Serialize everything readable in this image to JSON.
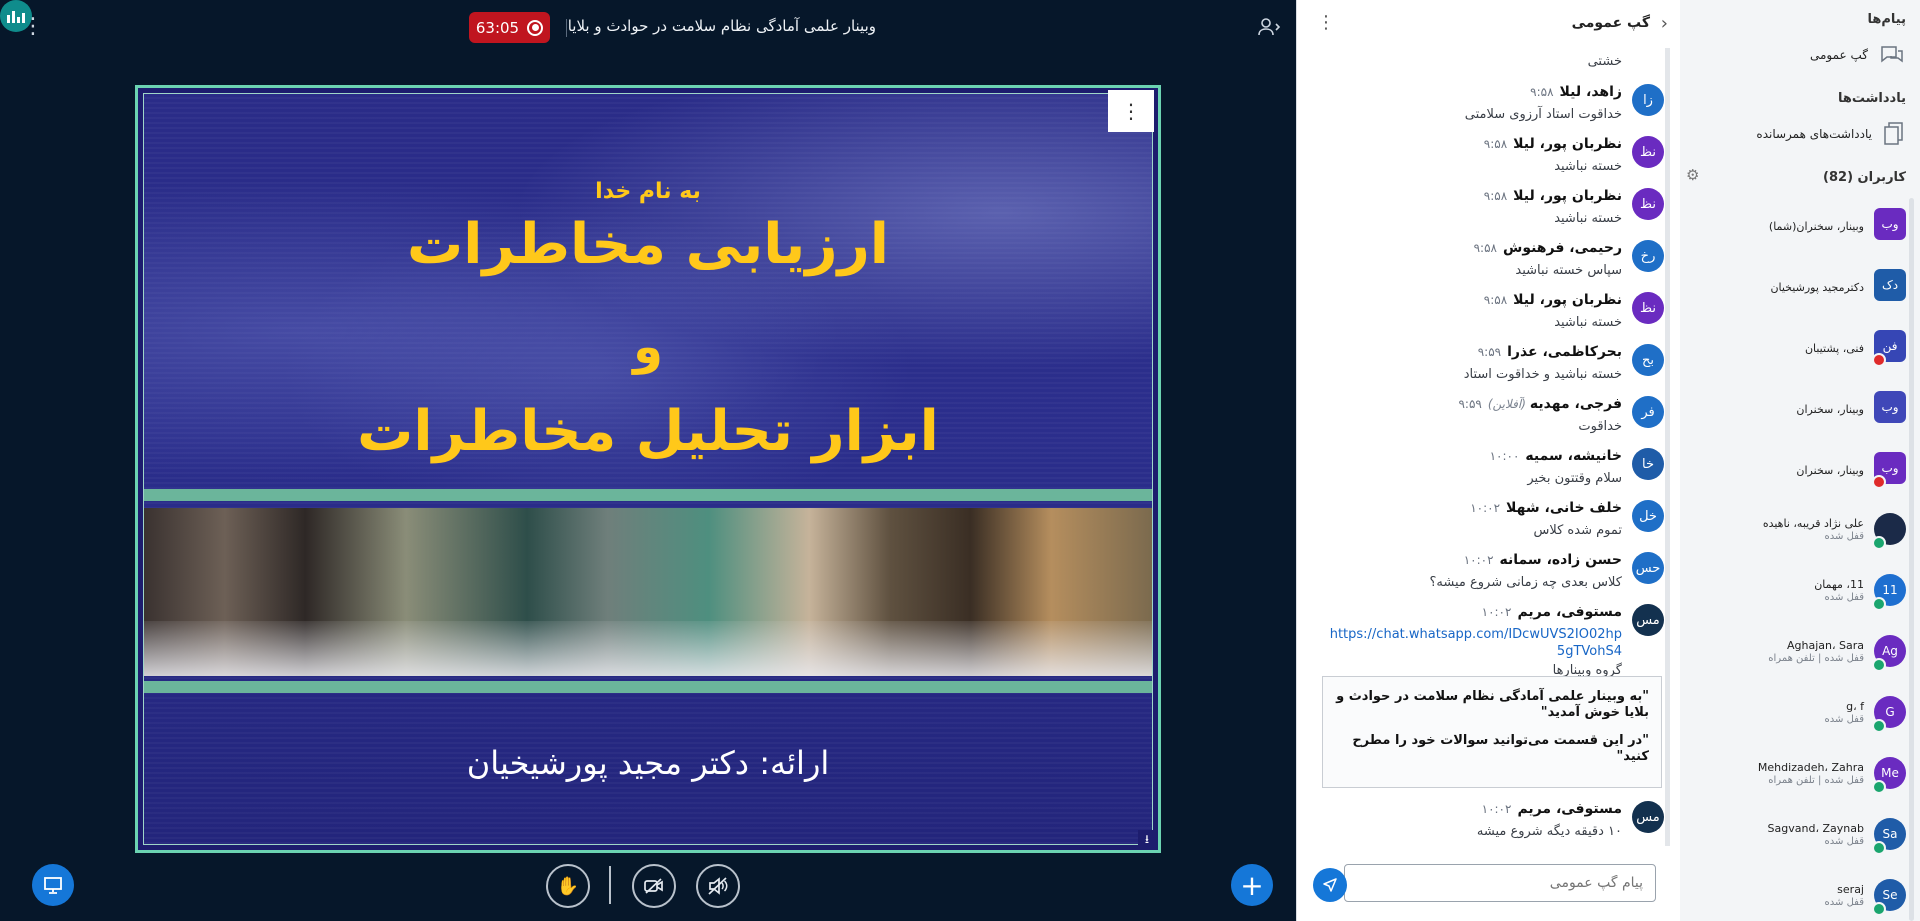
{
  "header": {
    "timer": "63:05",
    "meeting_title": "وبینار علمی آمادگی نظام سلامت در حوادث و بلایا"
  },
  "slide": {
    "line1": "به نام خدا",
    "title1": "ارزیابی مخاطرات",
    "and": "و",
    "title2": "ابزار تحلیل مخاطرات",
    "presenter": "ارائه: دکتر مجید پورشیخیان"
  },
  "chat": {
    "title": "گپ عمومی",
    "partial_text": "خشتی",
    "messages": [
      {
        "initials": "زا",
        "color": "#1f6fc7",
        "name": "زاهد، لیلا",
        "time": "۹:۵۸",
        "text": "خداقوت استاد آرزوی سلامتی"
      },
      {
        "initials": "نظ",
        "color": "#6a2bc0",
        "name": "نظربان پور، لیلا",
        "time": "۹:۵۸",
        "text": "خسته نباشید"
      },
      {
        "initials": "نظ",
        "color": "#6a2bc0",
        "name": "نظربان پور، لیلا",
        "time": "۹:۵۸",
        "text": "خسته نباشید"
      },
      {
        "initials": "رخ",
        "color": "#1f6fc7",
        "name": "رحیمی، فرهنوش",
        "time": "۹:۵۸",
        "text": "سپاس خسته نباشید"
      },
      {
        "initials": "نظ",
        "color": "#6a2bc0",
        "name": "نظربان پور، لیلا",
        "time": "۹:۵۸",
        "text": "خسته نباشید"
      },
      {
        "initials": "بح",
        "color": "#1f6fc7",
        "name": "بحرکاظمی، عذرا",
        "time": "۹:۵۹",
        "text": "خسته نباشید و خداقوت استاد"
      },
      {
        "initials": "فر",
        "color": "#1f6fc7",
        "name": "فرجی، مهدیه",
        "offline": "(آفلاین)",
        "time": "۹:۵۹",
        "text": "خداقوت"
      },
      {
        "initials": "خا",
        "color": "#1f5ca8",
        "name": "خانیشه، سمیه",
        "time": "۱۰:۰۰",
        "text": "سلام وقتتون بخیر"
      },
      {
        "initials": "خل",
        "color": "#1f6fc7",
        "name": "خلف خانی، شهلا",
        "time": "۱۰:۰۲",
        "text": "تموم شده کلاس"
      },
      {
        "initials": "حس",
        "color": "#1f6fc7",
        "name": "حسن زاده، سمانه",
        "time": "۱۰:۰۲",
        "text": "کلاس بعدی چه زمانی شروع میشه؟"
      },
      {
        "initials": "مس",
        "color": "#13314f",
        "name": "مستوفی، مریم",
        "time": "۱۰:۰۲",
        "link": "https://chat.whatsapp.com/IDcwUVS2IO02hp5gTVohS4",
        "text": "گروه وبینارها"
      }
    ],
    "welcome_line1": "\"به وبینار علمی آمادگی نظام سلامت در حوادث و بلایا خوش آمدید\"",
    "welcome_line2": "\"در این قسمت می‌توانید سوالات خود را مطرح کنید\"",
    "last_message": {
      "initials": "مس",
      "color": "#13314f",
      "name": "مستوفی، مریم",
      "time": "۱۰:۰۲",
      "text": "۱۰ دقیقه دیگه شروع میشه"
    },
    "input_placeholder": "پیام گپ عمومی"
  },
  "sidebar": {
    "messages_title": "پیام‌ها",
    "public_chat_label": "گپ عمومی",
    "notes_title": "یادداشت‌ها",
    "shared_notes_label": "یادداشت‌های همرسانده",
    "users_title": "کاربران (82)",
    "users": [
      {
        "initials": "وب",
        "color": "#6a2bc0",
        "name": "وبینار، سخنران",
        "you": "(شما)",
        "status": "",
        "badge": ""
      },
      {
        "initials": "دک",
        "color": "#1f5ca8",
        "name": "دکترمجید پورشیخیان",
        "you": "",
        "status": "",
        "badge": ""
      },
      {
        "initials": "فن",
        "color": "#3646b5",
        "name": "فنی، پشتیبان",
        "you": "",
        "status": "",
        "badge": "red"
      },
      {
        "initials": "وب",
        "color": "#3f47b8",
        "name": "وبینار، سخنران",
        "you": "",
        "status": "",
        "badge": ""
      },
      {
        "initials": "وب",
        "color": "#6a2bc0",
        "name": "وبینار، سخنران",
        "you": "",
        "status": "",
        "badge": "red"
      },
      {
        "initials": "",
        "color": "#1b2a48",
        "name": "علی نژاد قریبه، ناهیده",
        "you": "",
        "status": "قفل شده",
        "badge": "green"
      },
      {
        "initials": "11",
        "color": "#1e6fd0",
        "name": "11، مهمان",
        "you": "",
        "status": "قفل شده",
        "badge": "green"
      },
      {
        "initials": "Ag",
        "color": "#6a2bc0",
        "name": "Aghajan، Sara",
        "you": "",
        "status": "قفل شده | تلفن همراه",
        "badge": "green"
      },
      {
        "initials": "G",
        "color": "#6a2bc0",
        "name": "g، f",
        "you": "",
        "status": "قفل شده",
        "badge": "green"
      },
      {
        "initials": "Me",
        "color": "#6a2bc0",
        "name": "Mehdizadeh، Zahra",
        "you": "",
        "status": "قفل شده | تلفن همراه",
        "badge": "green"
      },
      {
        "initials": "Sa",
        "color": "#1f5ca8",
        "name": "Sagvand، Zaynab",
        "you": "",
        "status": "قفل شده",
        "badge": "green"
      },
      {
        "initials": "Se",
        "color": "#1f5ca8",
        "name": "seraj",
        "you": "",
        "status": "قفل شده",
        "badge": "green"
      }
    ]
  }
}
